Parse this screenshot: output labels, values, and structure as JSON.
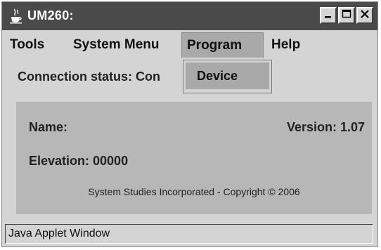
{
  "window": {
    "title": "UM260:",
    "icon": "java-cup-icon",
    "controls": {
      "minimize_icon": "minimize-icon",
      "maximize_icon": "maximize-icon",
      "close_icon": "close-icon"
    }
  },
  "menubar": {
    "items": [
      {
        "label": "Tools"
      },
      {
        "label": "System Menu"
      },
      {
        "label": "Program"
      },
      {
        "label": "Help"
      }
    ],
    "active_item": "Program"
  },
  "dropdown": {
    "items": [
      {
        "label": "Device"
      }
    ]
  },
  "connection": {
    "status_text": "Connection status: Con"
  },
  "panel": {
    "name_label": "Name:",
    "version_label": "Version: 1.07",
    "elevation_label": "Elevation: 00000",
    "copyright": "System Studies Incorporated - Copyright © 2006"
  },
  "statusbar": {
    "text": "Java Applet Window"
  },
  "colors": {
    "titlebar_bg": "#4a4a4a",
    "window_bg": "#d4d4d4",
    "panel_bg": "#b7b7b7",
    "menu_highlight": "#a9a9a9"
  }
}
